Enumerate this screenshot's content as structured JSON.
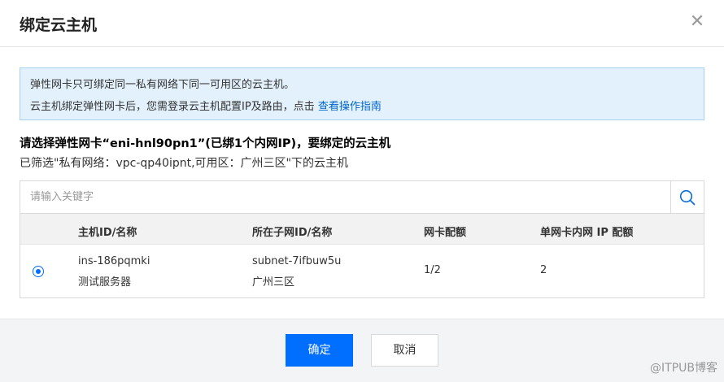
{
  "dialog": {
    "title": "绑定云主机",
    "close_icon": "close-icon"
  },
  "info": {
    "line1": "弹性网卡只可绑定同一私有网络下同一可用区的云主机。",
    "line2_prefix": "云主机绑定弹性网卡后，您需登录云主机配置IP及路由，点击",
    "line2_link": "查看操作指南"
  },
  "selection": {
    "title": "请选择弹性网卡“eni-hnl90pn1”(已绑1个内网IP)，要绑定的云主机",
    "filter_note": "已筛选\"私有网络：vpc-qp40ipnt,可用区：广州三区\"下的云主机"
  },
  "search": {
    "placeholder": "请输入关键字",
    "icon": "search-icon"
  },
  "table": {
    "headers": [
      "主机ID/名称",
      "所在子网ID/名称",
      "网卡配额",
      "单网卡内网 IP 配额"
    ],
    "rows": [
      {
        "selected": true,
        "host_id": "ins-186pqmki",
        "host_name": "测试服务器",
        "subnet_id": "subnet-7ifbuw5u",
        "subnet_name": "广州三区",
        "nic_quota": "1/2",
        "ip_quota": "2"
      }
    ]
  },
  "footer": {
    "confirm_label": "确定",
    "cancel_label": "取消"
  },
  "watermark": "@ITPUB博客",
  "colors": {
    "primary": "#006eff",
    "link": "#0066cc",
    "info_bg": "#e3f1fc",
    "info_border": "#a9d1f2"
  }
}
